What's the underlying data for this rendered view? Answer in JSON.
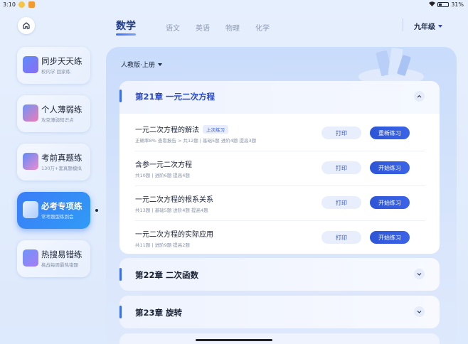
{
  "status_bar": {
    "time": "3:10",
    "battery": "31%"
  },
  "subjects": {
    "active": "数学",
    "tabs": [
      "语文",
      "英语",
      "物理",
      "化学"
    ]
  },
  "grade": "九年级",
  "sidebar": [
    {
      "title": "同步天天练",
      "subtitle": "校内学 回家练"
    },
    {
      "title": "个人薄弱练",
      "subtitle": "攻克薄弱知识点"
    },
    {
      "title": "考前真题练",
      "subtitle": "130万+套真题模拟"
    },
    {
      "title": "必考专项练",
      "subtitle": "常考题型练到会"
    },
    {
      "title": "热搜易错练",
      "subtitle": "挑战每周最热错题"
    }
  ],
  "textbook": "人教版·上册",
  "chapter21": {
    "title": "第21章 一元二次方程",
    "items": [
      {
        "name": "一元二次方程的解法",
        "tag": "上次练习",
        "meta": "正确率8%  查看报告 >     共12题 | 基础5题 进阶4题 提高3题",
        "print": "打印",
        "action": "重新练习"
      },
      {
        "name": "含参一元二次方程",
        "meta": "共10题 | 进阶6题 提高4题",
        "print": "打印",
        "action": "开始练习"
      },
      {
        "name": "一元二次方程的根系关系",
        "meta": "共13题 | 基础5题 进阶4题 提高4题",
        "print": "打印",
        "action": "开始练习"
      },
      {
        "name": "一元二次方程的实际应用",
        "meta": "共11题 | 进阶9题 提高2题",
        "print": "打印",
        "action": "开始练习"
      }
    ]
  },
  "chapter22": {
    "title": "第22章 二次函数"
  },
  "chapter23": {
    "title": "第23章 旋转"
  },
  "colors": {
    "accent": "#3b6cf6",
    "primary_button": "#2d56d6",
    "active_card": "#3b7df7"
  }
}
